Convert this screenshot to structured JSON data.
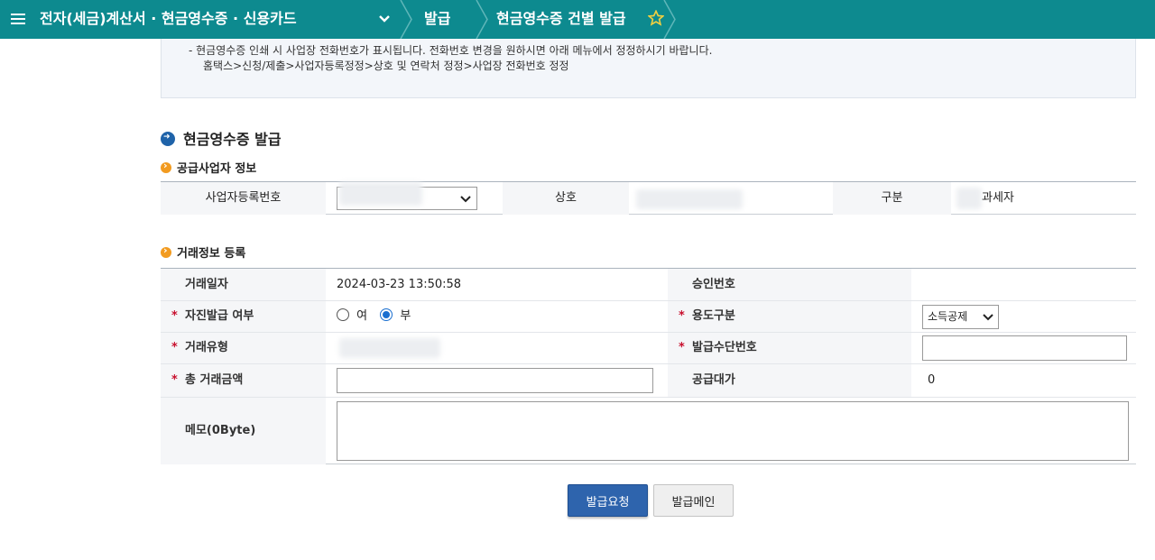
{
  "topbar": {
    "menu_title": "전자(세금)계산서 · 현금영수증 · 신용카드",
    "crumb_2": "발급",
    "crumb_3": "현금영수증 건별 발급",
    "accent": "#0d8a8f"
  },
  "notice": {
    "line1": "- 현금영수증 인쇄 시 사업장 전화번호가 표시됩니다. 전화번호 변경을 원하시면 아래 메뉴에서 정정하시기 바랍니다.",
    "line2": "홈택스>신청/제출>사업자등록정정>상호 및 연락처 정정>사업장 전화번호 정정"
  },
  "section_title": "현금영수증 발급",
  "supplier": {
    "heading": "공급사업자 정보",
    "biz_no_label": "사업자등록번호",
    "biz_no_value": "",
    "name_label": "상호",
    "name_value": "",
    "type_label": "구분",
    "type_value": "과세자"
  },
  "transaction": {
    "heading": "거래정보 등록",
    "date_label": "거래일자",
    "date_value": "2024-03-23 13:50:58",
    "approval_label": "승인번호",
    "approval_value": "",
    "self_issue_label": "자진발급 여부",
    "self_issue_options": [
      "여",
      "부"
    ],
    "self_issue_selected": "부",
    "usage_label": "용도구분",
    "usage_value": "소득공제",
    "trade_type_label": "거래유형",
    "method_no_label": "발급수단번호",
    "method_no_value": "",
    "total_label": "총 거래금액",
    "total_value": "",
    "supply_label": "공급대가",
    "supply_value": "0",
    "memo_label": "메모(0Byte)",
    "memo_value": "",
    "required_mark": "*"
  },
  "buttons": {
    "request": "발급요청",
    "main": "발급메인"
  }
}
